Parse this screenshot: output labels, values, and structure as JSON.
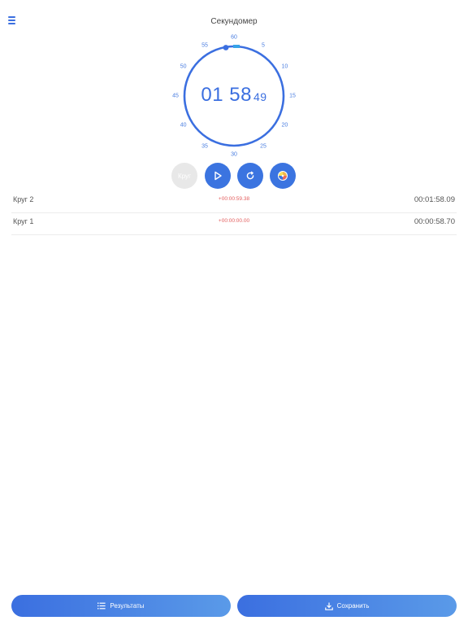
{
  "header": {
    "title": "Секундомер"
  },
  "icons": {
    "menu": "menu-icon",
    "play": "play-icon",
    "reset": "reset-icon",
    "theme": "theme-palette-icon",
    "list": "list-icon",
    "download": "download-icon"
  },
  "dial": {
    "ticks": [
      "60",
      "5",
      "10",
      "15",
      "20",
      "25",
      "30",
      "35",
      "40",
      "45",
      "50",
      "55"
    ],
    "minutes": "01",
    "seconds": "58",
    "hundredths": "49"
  },
  "controls": {
    "lap_label": "Круг"
  },
  "laps": [
    {
      "name": "Круг  2",
      "diff": "+00:00:59.38",
      "total": "00:01:58.09"
    },
    {
      "name": "Круг  1",
      "diff": "+00:00:00.00",
      "total": "00:00:58.70"
    }
  ],
  "footer": {
    "results_label": "Результаты",
    "save_label": "Сохранить"
  },
  "colors": {
    "accent": "#3b6fe0",
    "diff": "#e35d5d"
  }
}
